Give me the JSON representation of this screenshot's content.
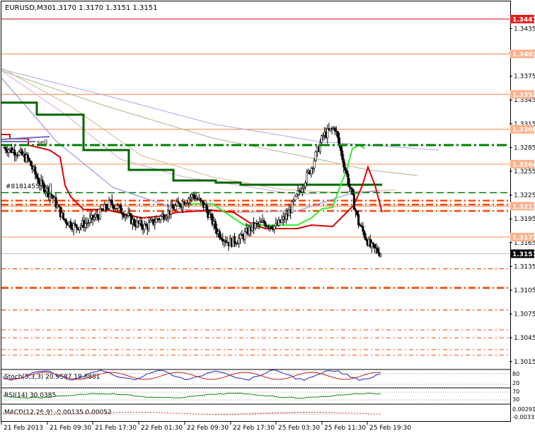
{
  "header": {
    "symbol": "EURUSD,M30",
    "ohlc": "1.3170 1.3170 1.3151 1.3151"
  },
  "orders": [
    {
      "label": "sell"
    },
    {
      "label": "#8181455 sell"
    }
  ],
  "price_axis": {
    "ticks": [
      "1.3435",
      "1.3405",
      "1.3375",
      "1.3345",
      "1.3315",
      "1.3285",
      "1.3255",
      "1.3225",
      "1.3195",
      "1.3165",
      "1.3135",
      "1.3105",
      "1.3075",
      "1.3045",
      "1.3015"
    ],
    "tags": [
      {
        "text": "1.3447",
        "bg": "#e02020"
      },
      {
        "text": "1.3403",
        "bg": "#ffb08a"
      },
      {
        "text": "1.3352",
        "bg": "#ffb08a"
      },
      {
        "text": "1.3308",
        "bg": "#ffb08a"
      },
      {
        "text": "1.3264",
        "bg": "#ffb08a"
      },
      {
        "text": "1.3211",
        "bg": "#ffb08a"
      },
      {
        "text": "1.3172",
        "bg": "#ffb08a"
      },
      {
        "text": "1.3151",
        "bg": "#000000"
      }
    ]
  },
  "time_axis": [
    "21 Feb 2013",
    "21 Feb 09:30",
    "21 Feb 17:30",
    "22 Feb 01:30",
    "22 Feb 09:30",
    "22 Feb 17:30",
    "25 Feb 03:30",
    "25 Feb 11:30",
    "25 Feb 19:30"
  ],
  "indicators": {
    "stoch": {
      "label": "Stoch(5,3,3) 20.9587 19.8881",
      "axis": [
        "80",
        "20"
      ]
    },
    "rsi": {
      "label": "RSI(14) 30.0385",
      "axis": [
        "70",
        "30"
      ]
    },
    "macd": {
      "label": "MACD(12,26,9) -0.00135 0.00052",
      "axis": [
        "0.00291",
        "-0.00333"
      ]
    }
  },
  "colors": {
    "resistance": "#ff9966",
    "dashed_red": "#ff4500",
    "stepline": "#006400",
    "trail_red": "#e00000",
    "trail_green": "#33ee33",
    "dash_green": "#008000"
  },
  "chart_data": {
    "type": "candlestick",
    "title": "EURUSD,M30",
    "xlabel": "",
    "ylabel": "",
    "ylim": [
      1.3005,
      1.3455
    ],
    "x": [
      "21 Feb 2013",
      "21 Feb 09:30",
      "21 Feb 17:30",
      "22 Feb 01:30",
      "22 Feb 09:30",
      "22 Feb 17:30",
      "25 Feb 03:30",
      "25 Feb 11:30",
      "25 Feb 19:30"
    ],
    "close_series": [
      1.3285,
      1.328,
      1.327,
      1.324,
      1.3225,
      1.3195,
      1.3185,
      1.319,
      1.32,
      1.3215,
      1.3205,
      1.319,
      1.3185,
      1.3195,
      1.3205,
      1.3215,
      1.3225,
      1.321,
      1.318,
      1.3165,
      1.317,
      1.3185,
      1.319,
      1.3185,
      1.32,
      1.323,
      1.326,
      1.33,
      1.331,
      1.325,
      1.319,
      1.316,
      1.3151
    ],
    "horizontal_levels": [
      1.3447,
      1.3403,
      1.3352,
      1.3308,
      1.3264,
      1.3211,
      1.3172,
      1.3151
    ],
    "last_price": 1.3151
  }
}
